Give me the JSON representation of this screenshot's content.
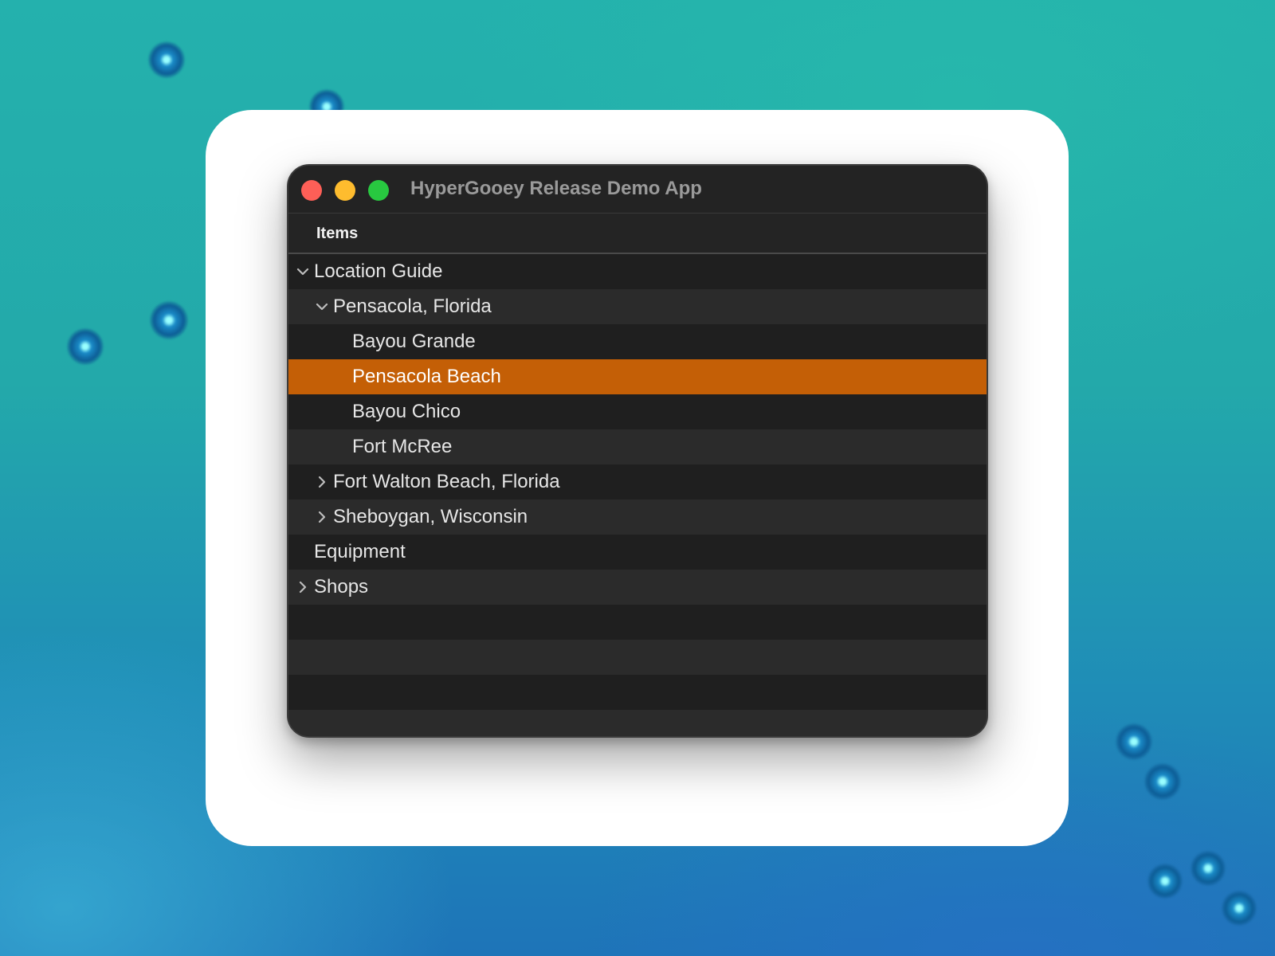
{
  "window": {
    "title": "HyperGooey Release Demo App"
  },
  "outline": {
    "column_header": "Items",
    "items": [
      {
        "label": "Location Guide",
        "level": 0,
        "disclosure": "expanded",
        "selected": false
      },
      {
        "label": "Pensacola, Florida",
        "level": 1,
        "disclosure": "expanded",
        "selected": false
      },
      {
        "label": "Bayou Grande",
        "level": 2,
        "disclosure": "none",
        "selected": false
      },
      {
        "label": "Pensacola Beach",
        "level": 2,
        "disclosure": "none",
        "selected": true
      },
      {
        "label": "Bayou Chico",
        "level": 2,
        "disclosure": "none",
        "selected": false
      },
      {
        "label": "Fort McRee",
        "level": 2,
        "disclosure": "none",
        "selected": false
      },
      {
        "label": "Fort Walton Beach, Florida",
        "level": 1,
        "disclosure": "collapsed",
        "selected": false
      },
      {
        "label": "Sheboygan, Wisconsin",
        "level": 1,
        "disclosure": "collapsed",
        "selected": false
      },
      {
        "label": "Equipment",
        "level": 0,
        "disclosure": "none",
        "selected": false
      },
      {
        "label": "Shops",
        "level": 0,
        "disclosure": "collapsed",
        "selected": false
      }
    ]
  },
  "colors": {
    "selection": "#c45f06",
    "close": "#fe5f57",
    "minimize": "#febc2e",
    "zoom": "#28c840"
  }
}
